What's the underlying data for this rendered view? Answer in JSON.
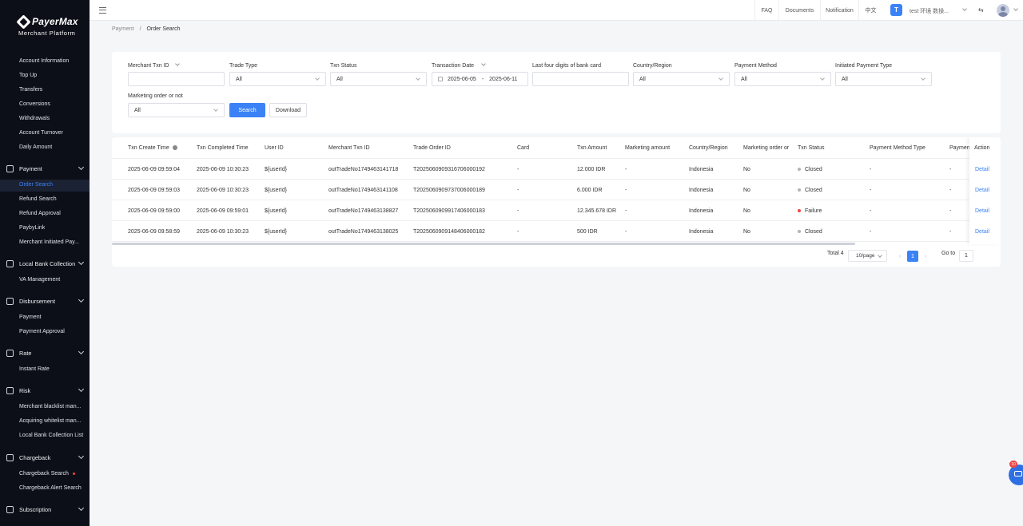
{
  "brand": {
    "name": "PayerMax",
    "subtitle": "Merchant  Platform"
  },
  "sidebar": {
    "top_items": [
      "Account Information",
      "Top Up",
      "Transfers",
      "Conversions",
      "Withdrawals",
      "Account Turnover",
      "Daily Amount"
    ],
    "groups": [
      {
        "label": "Payment",
        "icon": "card-icon",
        "items": [
          "Order Search",
          "Refund Search",
          "Refund Approval",
          "PaybyLink",
          "Merchant Initiated Pay..."
        ]
      },
      {
        "label": "Local Bank Collection",
        "icon": "bank-icon",
        "items": [
          "VA Management"
        ]
      },
      {
        "label": "Disbursement",
        "icon": "wallet-icon",
        "items": [
          "Payment",
          "Payment Approval"
        ]
      },
      {
        "label": "Rate",
        "icon": "exchange-icon",
        "items": [
          "Instant Rate"
        ]
      },
      {
        "label": "Risk",
        "icon": "shield-icon",
        "items": [
          "Merchant blacklist man...",
          "Acquiring whitelist man...",
          "Local Bank Collection List"
        ]
      },
      {
        "label": "Chargeback",
        "icon": "document-icon",
        "items": [
          "Chargeback Search",
          "Chargeback Alert Search"
        ]
      },
      {
        "label": "Subscription",
        "icon": "calendar-icon",
        "items": []
      }
    ],
    "active_item": "Order Search"
  },
  "topbar": {
    "links": [
      "FAQ",
      "Documents",
      "Notification",
      "中文"
    ],
    "user_initial": "T",
    "user_name": "test 环境 数操..."
  },
  "breadcrumb": {
    "parent": "Payment",
    "separator": "/",
    "current": "Order Search"
  },
  "filters": {
    "merchant_txn_id": {
      "label": "Merchant Txn ID",
      "value": ""
    },
    "trade_type": {
      "label": "Trade Type",
      "value": "All"
    },
    "txn_status": {
      "label": "Txn Status",
      "value": "All"
    },
    "transaction_date": {
      "label": "Transaction Date",
      "start": "2025-06-05",
      "separator": "-",
      "end": "2025-06-11"
    },
    "last_four": {
      "label": "Last four digits of bank card",
      "value": ""
    },
    "country_region": {
      "label": "Country/Region",
      "value": "All"
    },
    "payment_method": {
      "label": "Payment Method",
      "value": "All"
    },
    "initiated_payment_type": {
      "label": "Initiated Payment Type",
      "value": "All"
    },
    "marketing_order": {
      "label": "Marketing order or not",
      "value": "All"
    },
    "search_label": "Search",
    "download_label": "Download"
  },
  "table": {
    "columns": [
      "Txn Create Time",
      "Txn Completed Time",
      "User ID",
      "Merchant Txn ID",
      "Trade Order ID",
      "Card",
      "Txn Amount",
      "Marketing amount",
      "Country/Region",
      "Marketing order or",
      "Txn Status",
      "Payment Method Type",
      "Paymen",
      "Action"
    ],
    "rows": [
      {
        "create": "2025-06-09 09:59:04",
        "completed": "2025-06-09 10:30:23",
        "user": "${userId}",
        "merchant_txn": "outTradeNo1749463141718",
        "trade_order": "T2025060909316706000192",
        "card": "-",
        "amount": "12.000 IDR",
        "marketing": "-",
        "country": "Indonesia",
        "marketing_order": "No",
        "status": "Closed",
        "status_color": "#b0b4bc",
        "pm_type": "-",
        "pm": "-",
        "action": "Detail"
      },
      {
        "create": "2025-06-09 09:59:03",
        "completed": "2025-06-09 10:30:23",
        "user": "${userId}",
        "merchant_txn": "outTradeNo1749463141108",
        "trade_order": "T2025060909737006000189",
        "card": "-",
        "amount": "6.000 IDR",
        "marketing": "-",
        "country": "Indonesia",
        "marketing_order": "No",
        "status": "Closed",
        "status_color": "#b0b4bc",
        "pm_type": "-",
        "pm": "-",
        "action": "Detail"
      },
      {
        "create": "2025-06-09 09:59:00",
        "completed": "2025-06-09 09:59:01",
        "user": "${userId}",
        "merchant_txn": "outTradeNo1749463138827",
        "trade_order": "T2025060909917406000183",
        "card": "-",
        "amount": "12.345.678 IDR",
        "marketing": "-",
        "country": "Indonesia",
        "marketing_order": "No",
        "status": "Failure",
        "status_color": "#f04444",
        "pm_type": "-",
        "pm": "-",
        "action": "Detail"
      },
      {
        "create": "2025-06-09 09:58:59",
        "completed": "2025-06-09 10:30:23",
        "user": "${userId}",
        "merchant_txn": "outTradeNo1749463138025",
        "trade_order": "T2025060909148406000182",
        "card": "-",
        "amount": "500 IDR",
        "marketing": "-",
        "country": "Indonesia",
        "marketing_order": "No",
        "status": "Closed",
        "status_color": "#b0b4bc",
        "pm_type": "-",
        "pm": "-",
        "action": "Detail"
      }
    ]
  },
  "pagination": {
    "total_label": "Total 4",
    "page_size": "10/page",
    "current_page": "1",
    "goto_label": "Go to",
    "goto_value": "1"
  },
  "chat": {
    "badge": "10"
  },
  "colors": {
    "accent": "#3b82f6",
    "sidebar_bg": "#0c0f17",
    "failure": "#f04444",
    "closed": "#b0b4bc"
  }
}
